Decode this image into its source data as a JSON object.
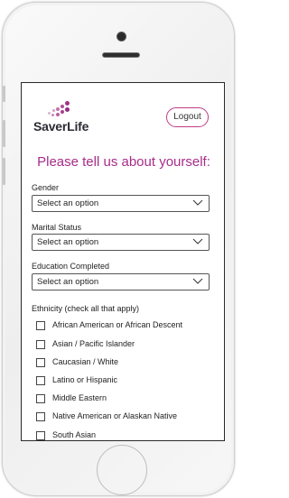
{
  "brand": {
    "name": "SaverLife"
  },
  "header": {
    "logout_label": "Logout"
  },
  "heading": "Please tell us about yourself:",
  "fields": [
    {
      "label": "Gender",
      "value": "Select an option"
    },
    {
      "label": "Marital Status",
      "value": "Select an option"
    },
    {
      "label": "Education Completed",
      "value": "Select an option"
    }
  ],
  "ethnicity": {
    "label": "Ethnicity (check all that apply)",
    "options": [
      {
        "label": "African American or African Descent",
        "checked": false
      },
      {
        "label": "Asian / Pacific Islander",
        "checked": false
      },
      {
        "label": "Caucasian / White",
        "checked": false
      },
      {
        "label": "Latino or Hispanic",
        "checked": false
      },
      {
        "label": "Middle Eastern",
        "checked": false
      },
      {
        "label": "Native American or Alaskan Native",
        "checked": false
      },
      {
        "label": "South Asian",
        "checked": false
      }
    ]
  },
  "colors": {
    "accent": "#a72c8a",
    "button_border": "#c03c86"
  },
  "icons": {
    "dropdown": "chevron-down-icon",
    "logo": "logo-dots-icon"
  }
}
